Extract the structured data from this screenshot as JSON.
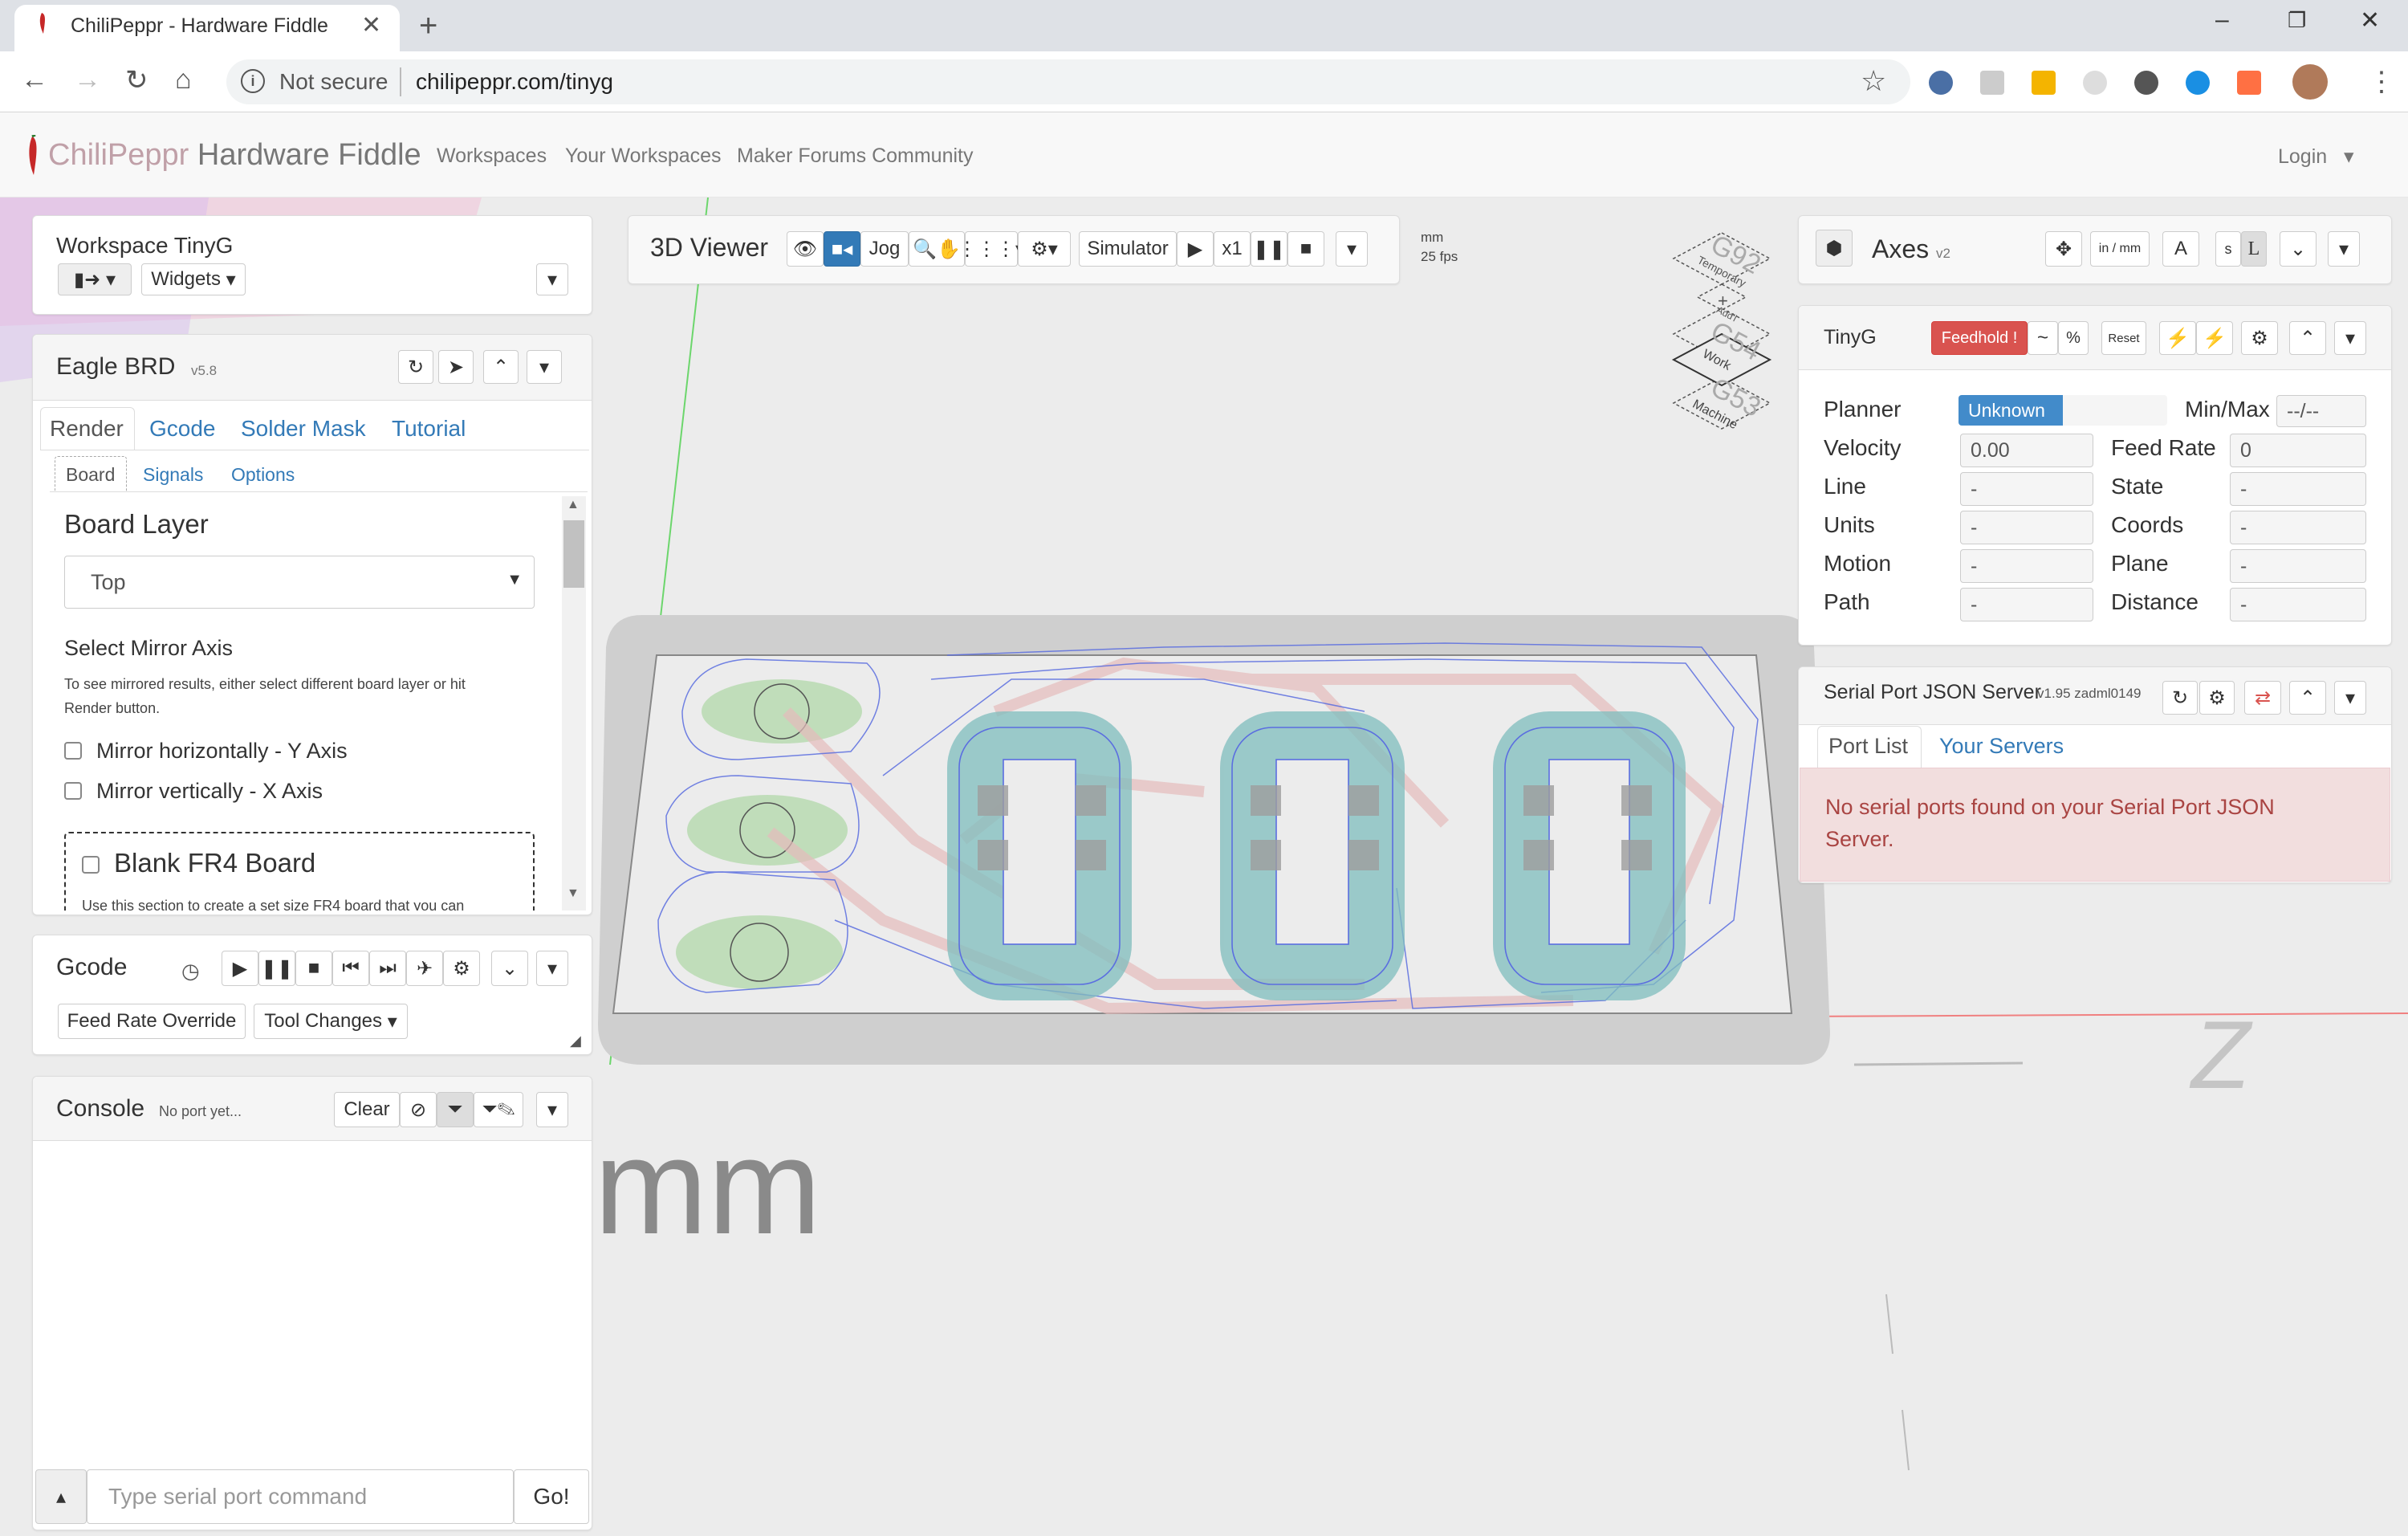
{
  "browser": {
    "tab_title": "ChiliPeppr - Hardware Fiddle",
    "security_label": "Not secure",
    "url": "chilipeppr.com/tinyg"
  },
  "nav": {
    "brand_part1": "ChiliPeppr",
    "brand_part2": "Hardware Fiddle",
    "links": [
      "Workspaces",
      "Your Workspaces",
      "Maker Forums Community"
    ],
    "login": "Login"
  },
  "workspace": {
    "title": "Workspace TinyG",
    "widgets_label": "Widgets"
  },
  "eagle": {
    "title": "Eagle BRD",
    "version": "v5.8",
    "tabs": [
      "Render",
      "Gcode",
      "Solder Mask",
      "Tutorial"
    ],
    "subtabs": [
      "Board",
      "Signals",
      "Options"
    ],
    "board_layer_heading": "Board Layer",
    "board_layer_value": "Top",
    "mirror_heading": "Select Mirror Axis",
    "mirror_help": "To see mirrored results, either select different board layer or hit",
    "mirror_help2": "Render button.",
    "mirror_h": "Mirror horizontally - Y Axis",
    "mirror_v": "Mirror vertically - X Axis",
    "blank_title": "Blank FR4 Board",
    "blank_help": "Use this section to create a set size FR4 board that you can"
  },
  "gcode": {
    "title": "Gcode",
    "feedrate_label": "Feed Rate Override",
    "toolchanges_label": "Tool Changes"
  },
  "console": {
    "title": "Console",
    "subtitle": "No port yet...",
    "clear_label": "Clear",
    "input_placeholder": "Type serial port command",
    "go_label": "Go!"
  },
  "viewer": {
    "title": "3D Viewer",
    "jog_label": "Jog",
    "simulator_label": "Simulator",
    "speed_label": "x1",
    "units": "mm",
    "fps": "25 fps",
    "big_unit": "mm",
    "axis_letter": "Z"
  },
  "wcs": {
    "g92": "G92",
    "g92_label": "Temporary",
    "plus": "+",
    "plus_label": "Add'l",
    "g54": "G54",
    "g54_label": "Work",
    "g53": "G53",
    "g53_label": "Machine"
  },
  "axes": {
    "title": "Axes",
    "version": "v2",
    "inmm_label": "in / mm",
    "a_label": "A",
    "s_label": "s",
    "l_label": "L"
  },
  "tinyg": {
    "title": "TinyG",
    "feedhold_label": "Feedhold !",
    "tilde_label": "~",
    "percent_label": "%",
    "reset_label": "Reset",
    "fields_left": [
      {
        "label": "Planner",
        "value": "Unknown"
      },
      {
        "label": "Velocity",
        "value": "0.00"
      },
      {
        "label": "Line",
        "value": "-"
      },
      {
        "label": "Units",
        "value": "-"
      },
      {
        "label": "Motion",
        "value": "-"
      },
      {
        "label": "Path",
        "value": "-"
      }
    ],
    "fields_right": [
      {
        "label": "Min/Max",
        "value": "--/--"
      },
      {
        "label": "Feed Rate",
        "value": "0"
      },
      {
        "label": "State",
        "value": "-"
      },
      {
        "label": "Coords",
        "value": "-"
      },
      {
        "label": "Plane",
        "value": "-"
      },
      {
        "label": "Distance",
        "value": "-"
      }
    ]
  },
  "spjs": {
    "title": "Serial Port JSON Server",
    "version": "v1.95 zadml0149",
    "tabs": [
      "Port List",
      "Your Servers"
    ],
    "alert": "No serial ports found on your Serial Port JSON",
    "alert2": "Server."
  },
  "colors": {
    "primary": "#337ab7",
    "danger": "#d9534f",
    "alert_bg": "#f2dede",
    "alert_text": "#a94442"
  }
}
